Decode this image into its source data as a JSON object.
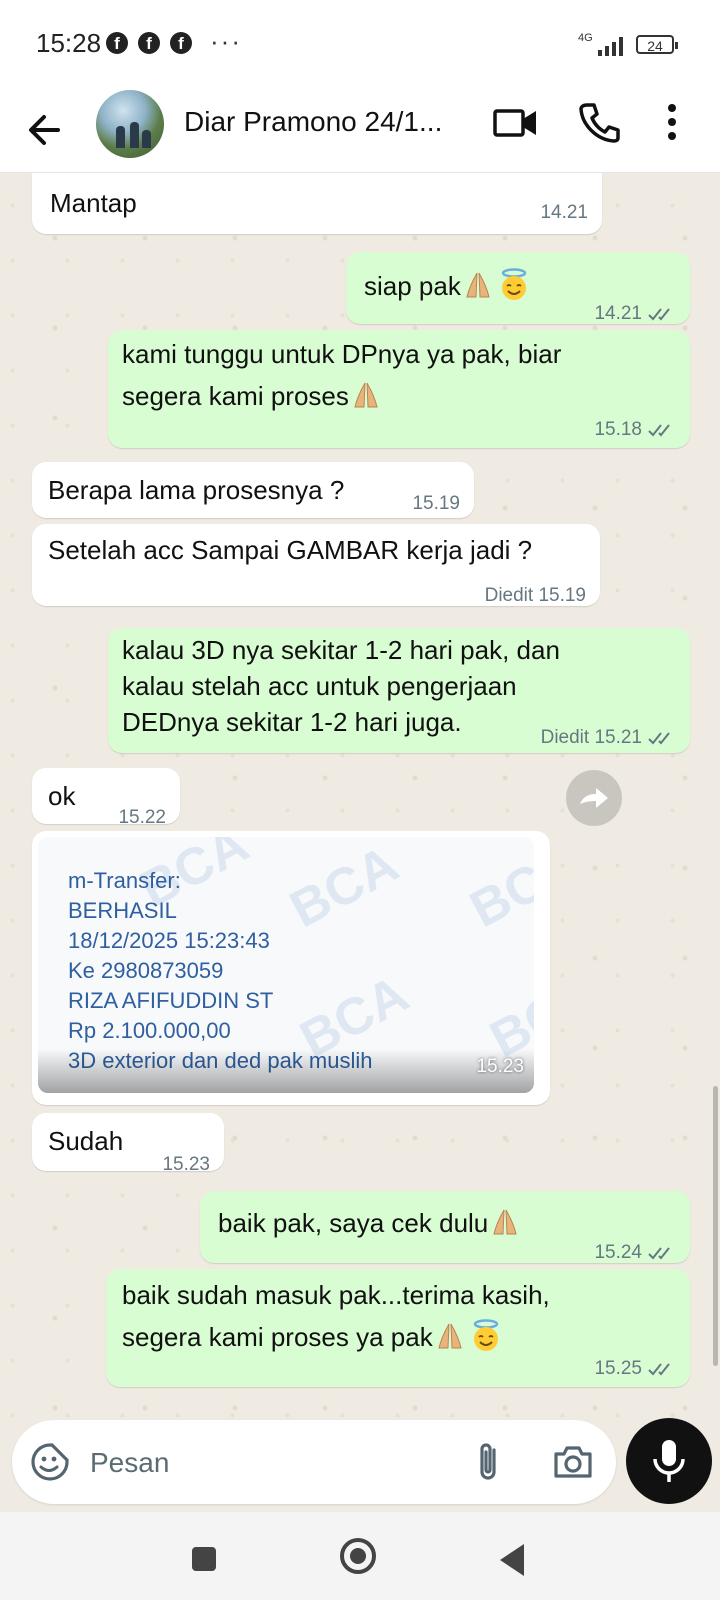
{
  "status": {
    "time": "15:28",
    "network": "4G",
    "battery": "24",
    "notif_glyph": "f",
    "more": "···"
  },
  "header": {
    "contact_name": "Diar Pramono 24/1..."
  },
  "messages": [
    {
      "dir": "in",
      "text": "Mantap",
      "time": "14.21"
    },
    {
      "dir": "out",
      "text": "siap pak",
      "time": "14.21",
      "emoji": [
        "folded-hands",
        "smiling-face-with-halo"
      ]
    },
    {
      "dir": "out",
      "lines": [
        "kami tunggu untuk DPnya ya pak, biar",
        "segera kami proses"
      ],
      "time": "15.18",
      "emoji": [
        "folded-hands"
      ]
    },
    {
      "dir": "in",
      "text": "Berapa lama prosesnya ?",
      "time": "15.19"
    },
    {
      "dir": "in",
      "text": "Setelah acc Sampai GAMBAR kerja jadi ?",
      "edited": "Diedit",
      "time": "15.19"
    },
    {
      "dir": "out",
      "lines": [
        "kalau 3D nya sekitar 1-2 hari pak, dan",
        "kalau stelah acc untuk pengerjaan",
        "DEDnya sekitar 1-2 hari juga."
      ],
      "edited": "Diedit",
      "time": "15.21"
    },
    {
      "dir": "in",
      "text": "ok",
      "time": "15.22"
    },
    {
      "dir": "in",
      "type": "image",
      "time": "15.23",
      "image_lines": [
        "m-Transfer:",
        "BERHASIL",
        "18/12/2025 15:23:43",
        "Ke 2980873059",
        "RIZA AFIFUDDIN ST",
        "Rp 2.100.000,00",
        "3D exterior dan ded pak muslih"
      ],
      "watermark": "BCA"
    },
    {
      "dir": "in",
      "text": "Sudah",
      "time": "15.23"
    },
    {
      "dir": "out",
      "text": "baik pak, saya cek dulu",
      "time": "15.24",
      "emoji": [
        "folded-hands"
      ]
    },
    {
      "dir": "out",
      "lines": [
        "baik sudah masuk pak...terima kasih,",
        "segera kami proses ya pak"
      ],
      "time": "15.25",
      "emoji": [
        "folded-hands",
        "smiling-face-with-halo"
      ]
    }
  ],
  "composer": {
    "placeholder": "Pesan"
  },
  "icons": {
    "back": "arrow-left-icon",
    "video": "video-camera-icon",
    "call": "phone-icon",
    "menu": "more-vertical-icon",
    "sticker": "sticker-icon",
    "attach": "paperclip-icon",
    "camera": "camera-icon",
    "mic": "microphone-icon",
    "forward": "forward-icon",
    "read": "double-check-icon"
  },
  "colors": {
    "outgoing_bubble": "#d9fdd3",
    "incoming_bubble": "#ffffff",
    "chat_bg": "#efeae2",
    "read_ticks": "#667781"
  }
}
